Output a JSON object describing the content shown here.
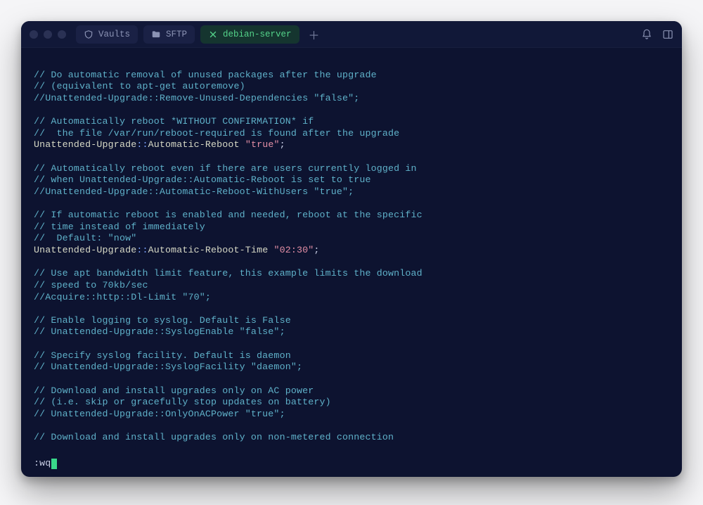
{
  "tabs": [
    {
      "label": "Vaults",
      "icon": "shield-icon",
      "active": false
    },
    {
      "label": "SFTP",
      "icon": "folder-icon",
      "active": false
    },
    {
      "label": "debian-server",
      "icon": "close-icon",
      "active": true
    }
  ],
  "editor": {
    "lines": [
      {
        "t": "blank"
      },
      {
        "t": "comment",
        "text": "// Do automatic removal of unused packages after the upgrade"
      },
      {
        "t": "comment",
        "text": "// (equivalent to apt-get autoremove)"
      },
      {
        "t": "comment",
        "text": "//Unattended-Upgrade::Remove-Unused-Dependencies \"false\";"
      },
      {
        "t": "blank"
      },
      {
        "t": "comment",
        "text": "// Automatically reboot *WITHOUT CONFIRMATION* if"
      },
      {
        "t": "comment",
        "text": "//  the file /var/run/reboot-required is found after the upgrade"
      },
      {
        "t": "setting",
        "keyPre": "Unattended-Upgrade",
        "keyPost": "Automatic-Reboot",
        "value": "\"true\""
      },
      {
        "t": "blank"
      },
      {
        "t": "comment",
        "text": "// Automatically reboot even if there are users currently logged in"
      },
      {
        "t": "comment",
        "text": "// when Unattended-Upgrade::Automatic-Reboot is set to true"
      },
      {
        "t": "comment",
        "text": "//Unattended-Upgrade::Automatic-Reboot-WithUsers \"true\";"
      },
      {
        "t": "blank"
      },
      {
        "t": "comment",
        "text": "// If automatic reboot is enabled and needed, reboot at the specific"
      },
      {
        "t": "comment",
        "text": "// time instead of immediately"
      },
      {
        "t": "comment",
        "text": "//  Default: \"now\""
      },
      {
        "t": "setting",
        "keyPre": "Unattended-Upgrade",
        "keyPost": "Automatic-Reboot-Time",
        "value": "\"02:30\""
      },
      {
        "t": "blank"
      },
      {
        "t": "comment",
        "text": "// Use apt bandwidth limit feature, this example limits the download"
      },
      {
        "t": "comment",
        "text": "// speed to 70kb/sec"
      },
      {
        "t": "comment",
        "text": "//Acquire::http::Dl-Limit \"70\";"
      },
      {
        "t": "blank"
      },
      {
        "t": "comment",
        "text": "// Enable logging to syslog. Default is False"
      },
      {
        "t": "comment",
        "text": "// Unattended-Upgrade::SyslogEnable \"false\";"
      },
      {
        "t": "blank"
      },
      {
        "t": "comment",
        "text": "// Specify syslog facility. Default is daemon"
      },
      {
        "t": "comment",
        "text": "// Unattended-Upgrade::SyslogFacility \"daemon\";"
      },
      {
        "t": "blank"
      },
      {
        "t": "comment",
        "text": "// Download and install upgrades only on AC power"
      },
      {
        "t": "comment",
        "text": "// (i.e. skip or gracefully stop updates on battery)"
      },
      {
        "t": "comment",
        "text": "// Unattended-Upgrade::OnlyOnACPower \"true\";"
      },
      {
        "t": "blank"
      },
      {
        "t": "comment",
        "text": "// Download and install upgrades only on non-metered connection"
      }
    ],
    "command": ":wq"
  }
}
